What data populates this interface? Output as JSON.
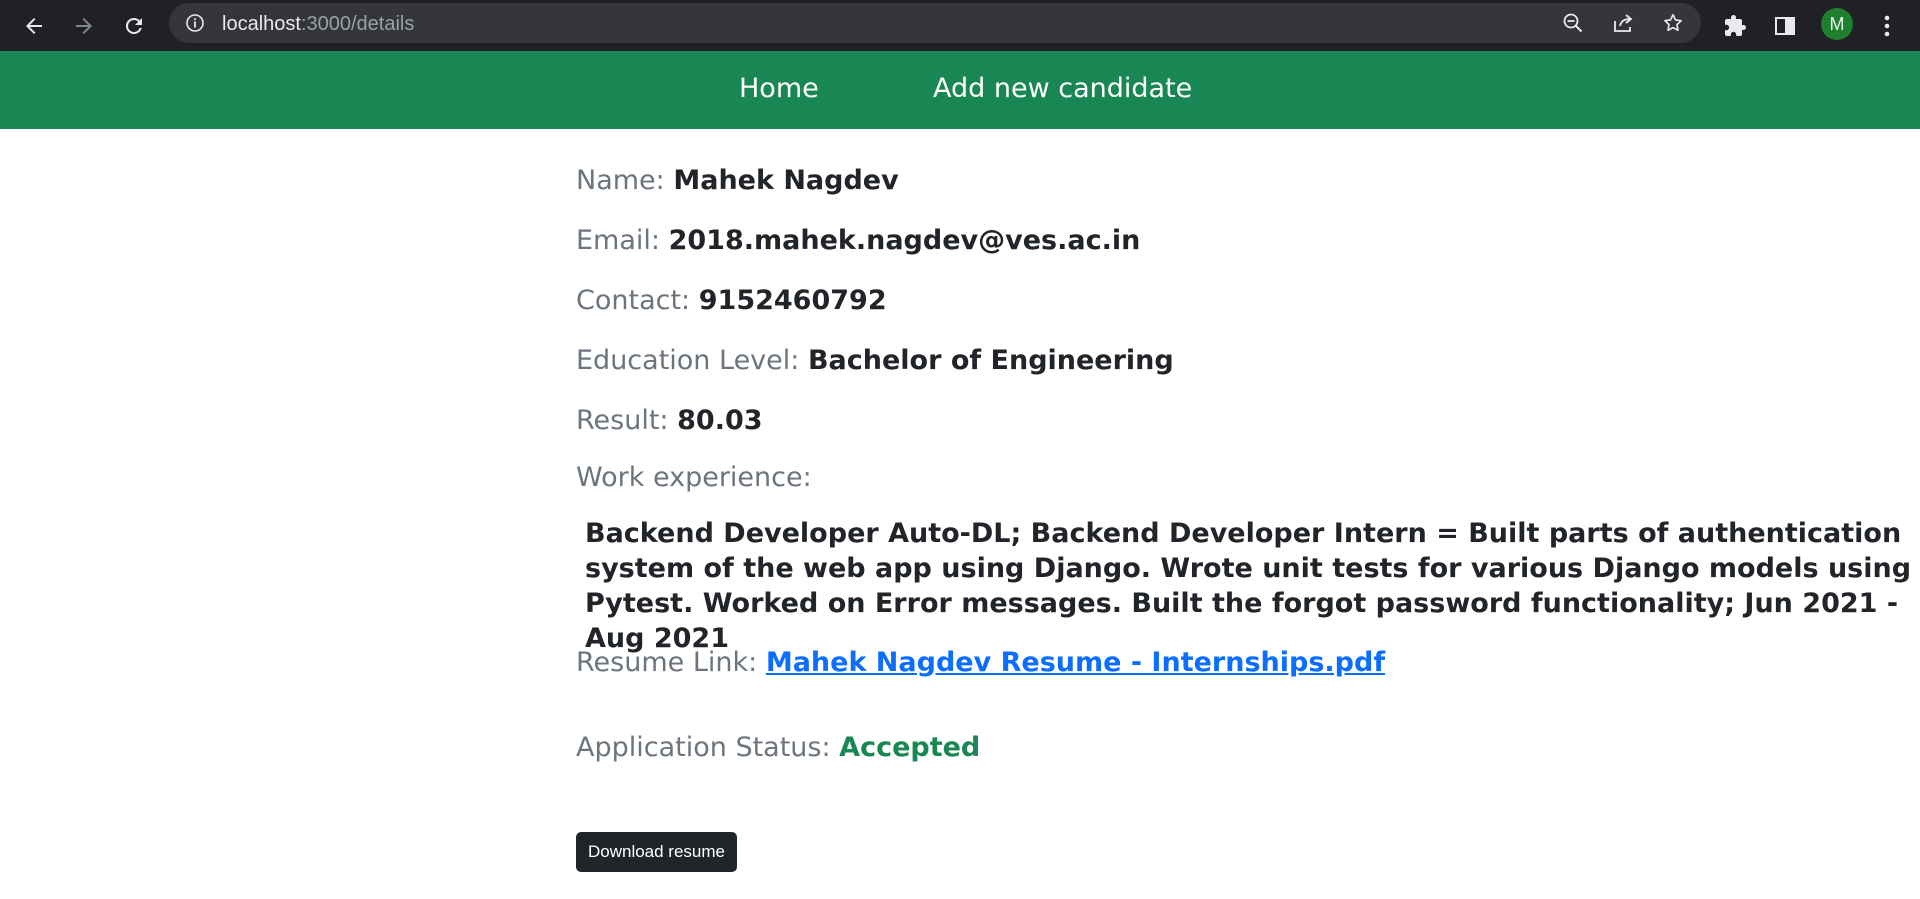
{
  "browser": {
    "url_host": "localhost",
    "url_path": ":3000/details",
    "avatar_initial": "M",
    "icons": [
      "back-icon",
      "forward-icon",
      "reload-icon",
      "info-icon",
      "zoom-out-icon",
      "share-icon",
      "star-icon",
      "extensions-icon",
      "side-panel-icon",
      "more-icon"
    ]
  },
  "nav": {
    "home": "Home",
    "add_candidate": "Add new candidate"
  },
  "details": {
    "name_label": "Name:",
    "name": "Mahek Nagdev",
    "email_label": "Email:",
    "email": "2018.mahek.nagdev@ves.ac.in",
    "contact_label": "Contact:",
    "contact": "9152460792",
    "education_label": "Education Level:",
    "education": "Bachelor of Engineering",
    "result_label": "Result:",
    "result": "80.03",
    "work_label": "Work experience:",
    "work": "Backend Developer Auto-DL; Backend Developer Intern = Built parts of authentication system of the web app using Django. Wrote unit tests for various Django models using Pytest. Worked on Error messages. Built the forgot password functionality; Jun 2021 - Aug 2021",
    "resume_label": "Resume Link:",
    "resume_link": "Mahek Nagdev Resume - Internships.pdf",
    "status_label": "Application Status:",
    "status": "Accepted",
    "status_color": "#198754"
  },
  "actions": {
    "download": "Download resume"
  },
  "colors": {
    "navbar": "#198754",
    "link": "#0d6efd",
    "chrome": "#202124"
  }
}
